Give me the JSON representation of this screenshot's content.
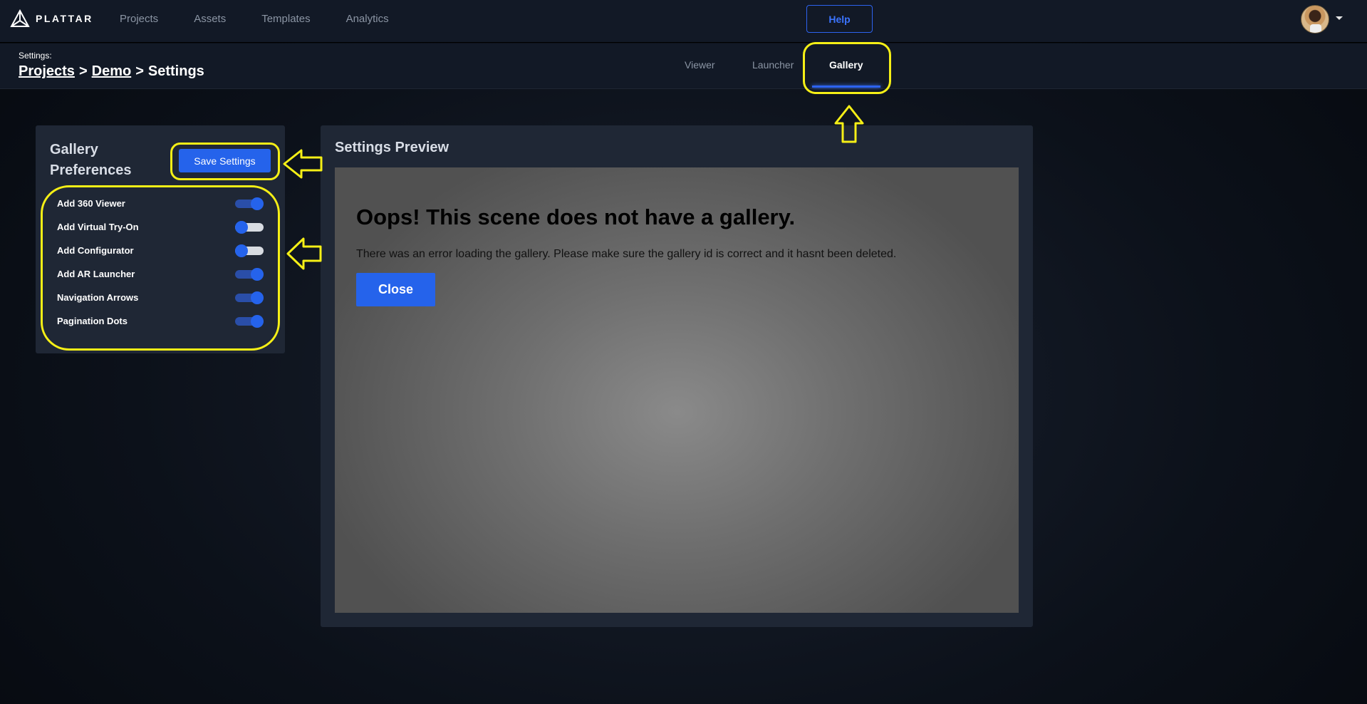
{
  "app": {
    "brand": "PLATTAR",
    "nav": [
      "Projects",
      "Assets",
      "Templates",
      "Analytics"
    ],
    "help_label": "Help"
  },
  "header": {
    "caption": "Settings:",
    "breadcrumb": [
      "Projects",
      "Demo",
      "Settings"
    ],
    "separator": ">",
    "tabs": [
      "Viewer",
      "Launcher",
      "Gallery"
    ],
    "active_tab": "Gallery"
  },
  "preferences": {
    "title": "Gallery Preferences",
    "save_label": "Save Settings",
    "items": [
      {
        "label": "Add 360 Viewer",
        "enabled": true
      },
      {
        "label": "Add Virtual Try-On",
        "enabled": false
      },
      {
        "label": "Add Configurator",
        "enabled": false
      },
      {
        "label": "Add AR Launcher",
        "enabled": true
      },
      {
        "label": "Navigation Arrows",
        "enabled": true
      },
      {
        "label": "Pagination Dots",
        "enabled": true
      }
    ]
  },
  "preview": {
    "title": "Settings Preview",
    "error_title": "Oops! This scene does not have a gallery.",
    "error_message": "There was an error loading the gallery. Please make sure the gallery id is correct and it hasnt been deleted.",
    "close_label": "Close"
  },
  "colors": {
    "accent": "#2563eb",
    "annotation": "#f5ef16",
    "panel": "#1f2735",
    "topbar": "#121926"
  }
}
